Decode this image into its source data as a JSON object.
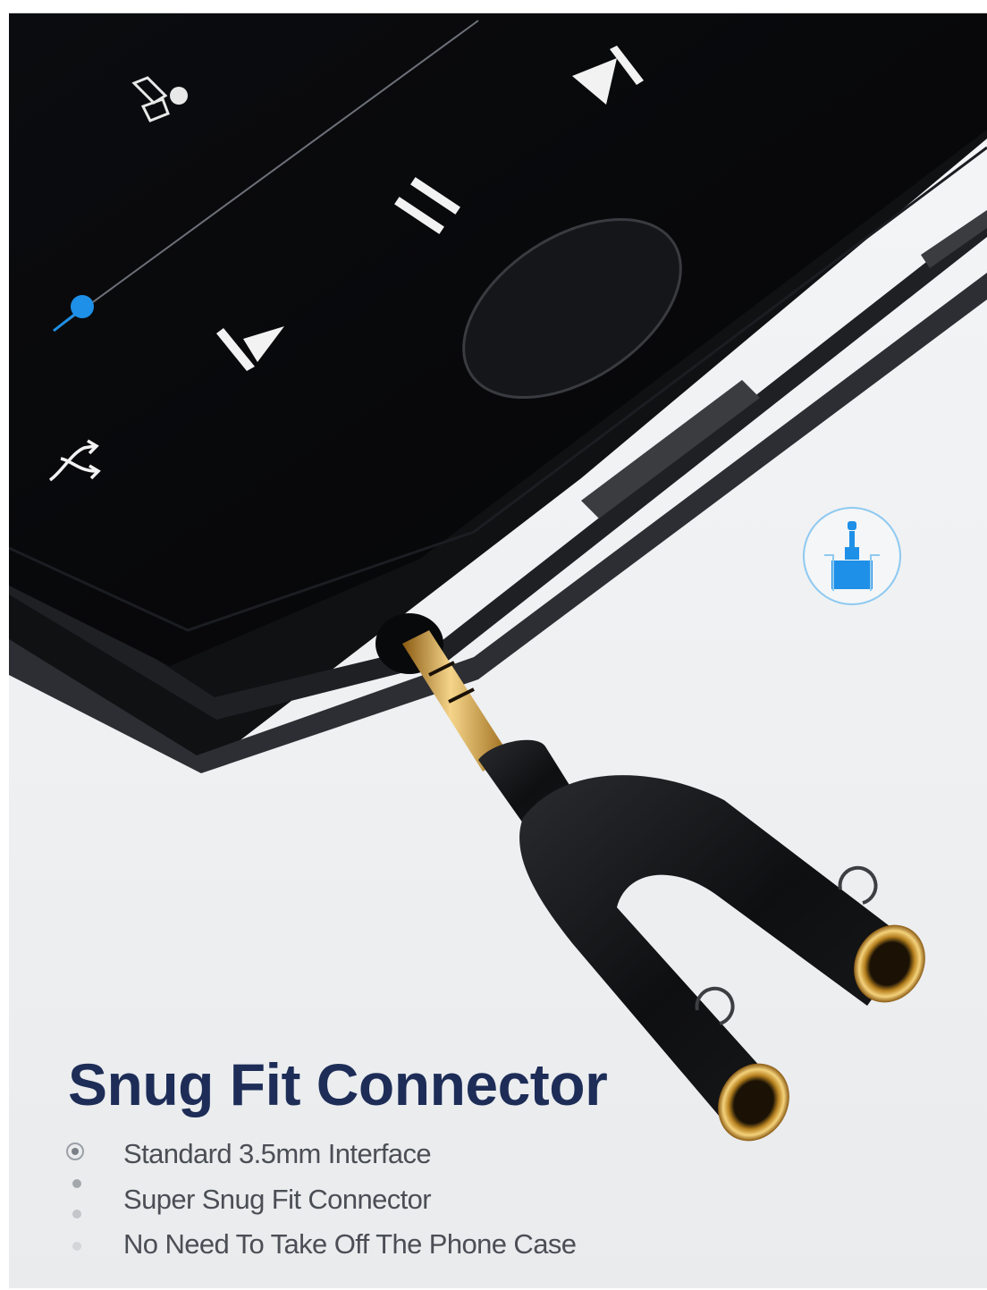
{
  "headline": "Snug Fit Connector",
  "features": [
    "Standard 3.5mm Interface",
    "Super Snug Fit Connector",
    "No Need To Take Off The Phone Case"
  ],
  "player": {
    "icons": [
      "add-to-playlist-icon",
      "next-track-icon",
      "pause-icon",
      "previous-track-icon",
      "shuffle-icon"
    ],
    "progress": 0.03
  },
  "colors": {
    "headline": "#1d2d57",
    "text": "#4b4f55",
    "accent_blue": "#1e90e8",
    "gold": "#d7a436",
    "background": "#eef0f2"
  }
}
